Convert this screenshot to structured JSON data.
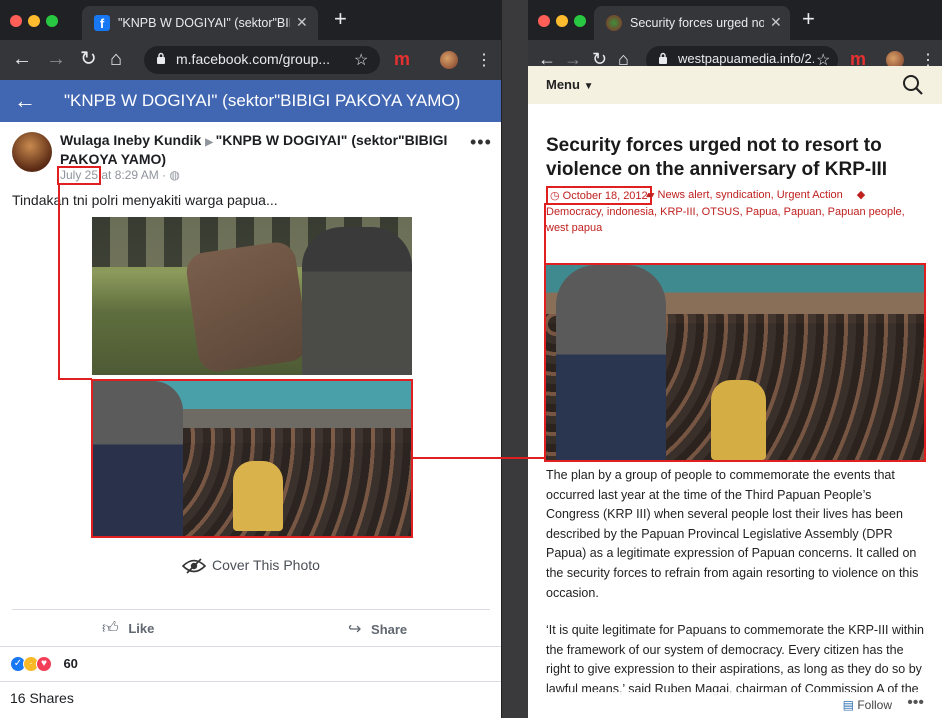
{
  "left_window": {
    "tab_title": "\"KNPB W DOGIYAI\" (sektor\"BIBI",
    "url": "m.facebook.com/group...",
    "group_header": "\"KNPB W DOGIYAI\" (sektor\"BIBIGI PAKOYA YAMO)",
    "post": {
      "author": "Wulaga Ineby Kundik",
      "group": "\"KNPB W DOGIYAI\" (sektor\"BIBIGI PAKOYA YAMO)",
      "date": "July 25",
      "time": "at 8:29 AM · ",
      "text": "Tindakan tni polri menyakiti warga papua...",
      "cover_label": "Cover This Photo",
      "like_label": "Like",
      "share_label": "Share",
      "reaction_count": "60",
      "shares": "16 Shares"
    }
  },
  "right_window": {
    "tab_title": "Security forces urged not to re",
    "url": "westpapuamedia.info/2...",
    "menu_label": "Menu",
    "article": {
      "title": "Security forces urged not to resort to violence on the anniversary of KRP-III",
      "date": "October 18, 2012",
      "categories": "News alert, syndication, Urgent Action",
      "tags": "Democracy, indonesia, KRP-III, OTSUS, Papua, Papuan, Papuan people, west papua",
      "paragraph1": "The plan by a group of people to commemorate the events that occurred last year at the time of the Third Papuan People’s Congress (KRP III)  when several people lost their lives has been described by the Papuan Provincal Legislative Assembly (DPR Papua) as a legitimate expression of Papuan concerns. It called on the security forces to refrain from again resorting to violence on this occasion.",
      "paragraph2": "‘It is quite legitimate for Papuans to commemorate the KRP-III within the framework of our system of democracy. Every citizen has the right to give expression to their aspirations, as long as they do so by lawful means,’ said Ruben Magai, chairman of Commission A of the",
      "follow_label": "Follow"
    }
  },
  "colors": {
    "facebook_blue": "#4267b2",
    "annotation_red": "#e02020",
    "link_red": "#c02020",
    "chrome_dark": "#202124"
  }
}
